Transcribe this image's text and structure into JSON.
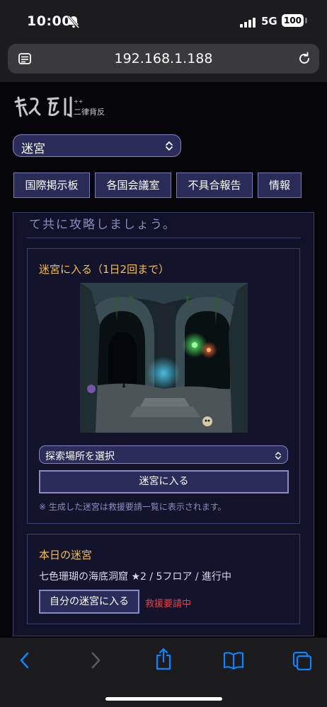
{
  "status_bar": {
    "time": "10:00",
    "network": "5G",
    "battery": "100"
  },
  "browser": {
    "url": "192.168.1.188"
  },
  "site": {
    "logo_text": "二律背反",
    "location_select": "迷宮",
    "nav": [
      "国際掲示板",
      "各国会議室",
      "不具合報告",
      "情報"
    ]
  },
  "panel": {
    "intro_text": "て共に攻略しましょう。",
    "labyrinth": {
      "title": "迷宮に入る（1日2回まで）",
      "select_placeholder": "探索場所を選択",
      "enter_button": "迷宮に入る",
      "note": "※ 生成した迷宮は救援要請一覧に表示されます。"
    },
    "today": {
      "title": "本日の迷宮",
      "info": "七色珊瑚の海底洞窟 ★2 / 5フロア / 進行中",
      "enter_own_button": "自分の迷宮に入る",
      "rescue_status": "救援要請中"
    }
  },
  "colors": {
    "accent_gold": "#f3c04e",
    "alert_red": "#e0404c",
    "ios_blue": "#0a84ff"
  }
}
